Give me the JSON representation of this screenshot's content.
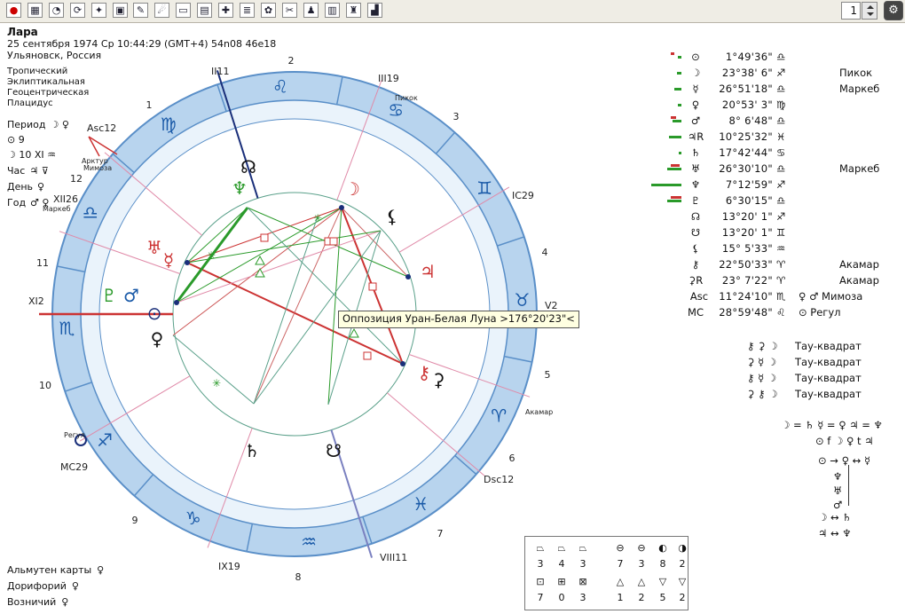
{
  "toolbar": {
    "icons": [
      "stop-icon",
      "grid-icon",
      "globe-icon",
      "refresh-icon",
      "star-map-icon",
      "chart-icon",
      "edit-icon",
      "comet-icon",
      "window-icon",
      "table-icon",
      "crosshair-icon",
      "list-icon",
      "wheel-icon",
      "tools-icon",
      "person-icon",
      "bar-chart-icon"
    ],
    "spin_value": "1"
  },
  "person": {
    "name": "Лара",
    "datetime": "25 сентября 1974  Ср  10:44:29 (GMT+4) 54n08  46e18",
    "place": "Ульяновск, Россия",
    "settings": [
      "Тропический",
      "Эклиптикальная",
      "Геоцентрическая",
      "Плацидус"
    ]
  },
  "rulers": [
    {
      "label": "Период",
      "value": "☽ ♀"
    },
    {
      "label": "",
      "value": "⊙  9"
    },
    {
      "label": "",
      "value": "☽  10 XI ♒"
    },
    {
      "label": "Час",
      "value": "♃ ⊽"
    },
    {
      "label": "День",
      "value": "♀"
    },
    {
      "label": "Год",
      "value": "♂ ♀"
    }
  ],
  "bottom_left": [
    {
      "label": "Альмутен карты",
      "value": "♀"
    },
    {
      "label": "Дорифорий",
      "value": "♀"
    },
    {
      "label": "Возничий",
      "value": "♀"
    }
  ],
  "positions": [
    {
      "g": "⊙",
      "pos": "1°49'36\"",
      "sign": "♎",
      "note": ""
    },
    {
      "g": "☽",
      "pos": "23°38' 6\"",
      "sign": "♐",
      "note": "Пикок"
    },
    {
      "g": "☿",
      "pos": "26°51'18\"",
      "sign": "♎",
      "note": "Маркеб"
    },
    {
      "g": "♀",
      "pos": "20°53' 3\"",
      "sign": "♍",
      "note": ""
    },
    {
      "g": "♂",
      "pos": "8° 6'48\"",
      "sign": "♎",
      "note": ""
    },
    {
      "g": "♃R",
      "pos": "10°25'32\"",
      "sign": "♓",
      "note": ""
    },
    {
      "g": "♄",
      "pos": "17°42'44\"",
      "sign": "♋",
      "note": ""
    },
    {
      "g": "♅",
      "pos": "26°30'10\"",
      "sign": "♎",
      "note": "Маркеб"
    },
    {
      "g": "♆",
      "pos": "7°12'59\"",
      "sign": "♐",
      "note": ""
    },
    {
      "g": "♇",
      "pos": "6°30'15\"",
      "sign": "♎",
      "note": ""
    },
    {
      "g": "☊",
      "pos": "13°20' 1\"",
      "sign": "♐",
      "note": ""
    },
    {
      "g": "☋",
      "pos": "13°20' 1\"",
      "sign": "♊",
      "note": ""
    },
    {
      "g": "⚸",
      "pos": "15° 5'33\"",
      "sign": "♒",
      "note": ""
    },
    {
      "g": "⚷",
      "pos": "22°50'33\"",
      "sign": "♈",
      "note": "Акамар"
    },
    {
      "g": "⚳R",
      "pos": "23° 7'22\"",
      "sign": "♈",
      "note": "Акамар"
    },
    {
      "g": "Asc",
      "pos": "11°24'10\"",
      "sign": "♏",
      "note": "♀ ♂  Мимоза"
    },
    {
      "g": "MC",
      "pos": "28°59'48\"",
      "sign": "♌",
      "note": "⊙  Регул"
    }
  ],
  "configs": [
    {
      "g": "⚷ ⚳ ☽",
      "label": "Тау-квадрат"
    },
    {
      "g": "⚳ ☿ ☽",
      "label": "Тау-квадрат"
    },
    {
      "g": "⚷ ☿ ☽",
      "label": "Тау-квадрат"
    },
    {
      "g": "⚳ ⚷ ☽",
      "label": "Тау-квадрат"
    }
  ],
  "receptions": [
    "☽ = ♄  ☿ = ♀  ♃ = ♆",
    "⊙ f ☽  ♀ t ♃",
    "⊙ → ♀ ↔ ☿",
    "♆",
    "♅",
    "♂",
    "☽ ↔ ♄",
    "♃ ↔ ♆"
  ],
  "tooltip": "Оппозиция Уран-Белая Луна >176°20'23\"<",
  "wheel": {
    "houses": [
      "1",
      "2",
      "3",
      "4",
      "5",
      "6",
      "7",
      "8",
      "9",
      "10",
      "11",
      "12"
    ],
    "cusp_labels": {
      "asc": "Asc12",
      "ic": "IC29",
      "dsc": "Dsc12",
      "mc": "MC29",
      "ii": "II11",
      "iii": "III19",
      "viii": "VIII11",
      "ix": "IX19",
      "xi": "XI2",
      "xii": "XII26",
      "v2": "V2"
    },
    "stars": {
      "pikok": "Пикок",
      "arcturus": "Арктур",
      "mimosa": "Мимоза",
      "markeb": "Маркеб",
      "regul": "Регул",
      "akamar": "Акамар"
    }
  },
  "aspect_table": {
    "row1_icons": [
      "⏢",
      "⏢",
      "⏢",
      "⊖",
      "⊖",
      "◐",
      "◑"
    ],
    "row1_counts": [
      "3",
      "4",
      "3",
      "7",
      "3",
      "8",
      "2"
    ],
    "row2_icons": [
      "⊡",
      "⊞",
      "⊠",
      "△",
      "△",
      "▽",
      "▽"
    ],
    "row2_counts": [
      "7",
      "0",
      "3",
      "1",
      "2",
      "5",
      "2"
    ]
  }
}
